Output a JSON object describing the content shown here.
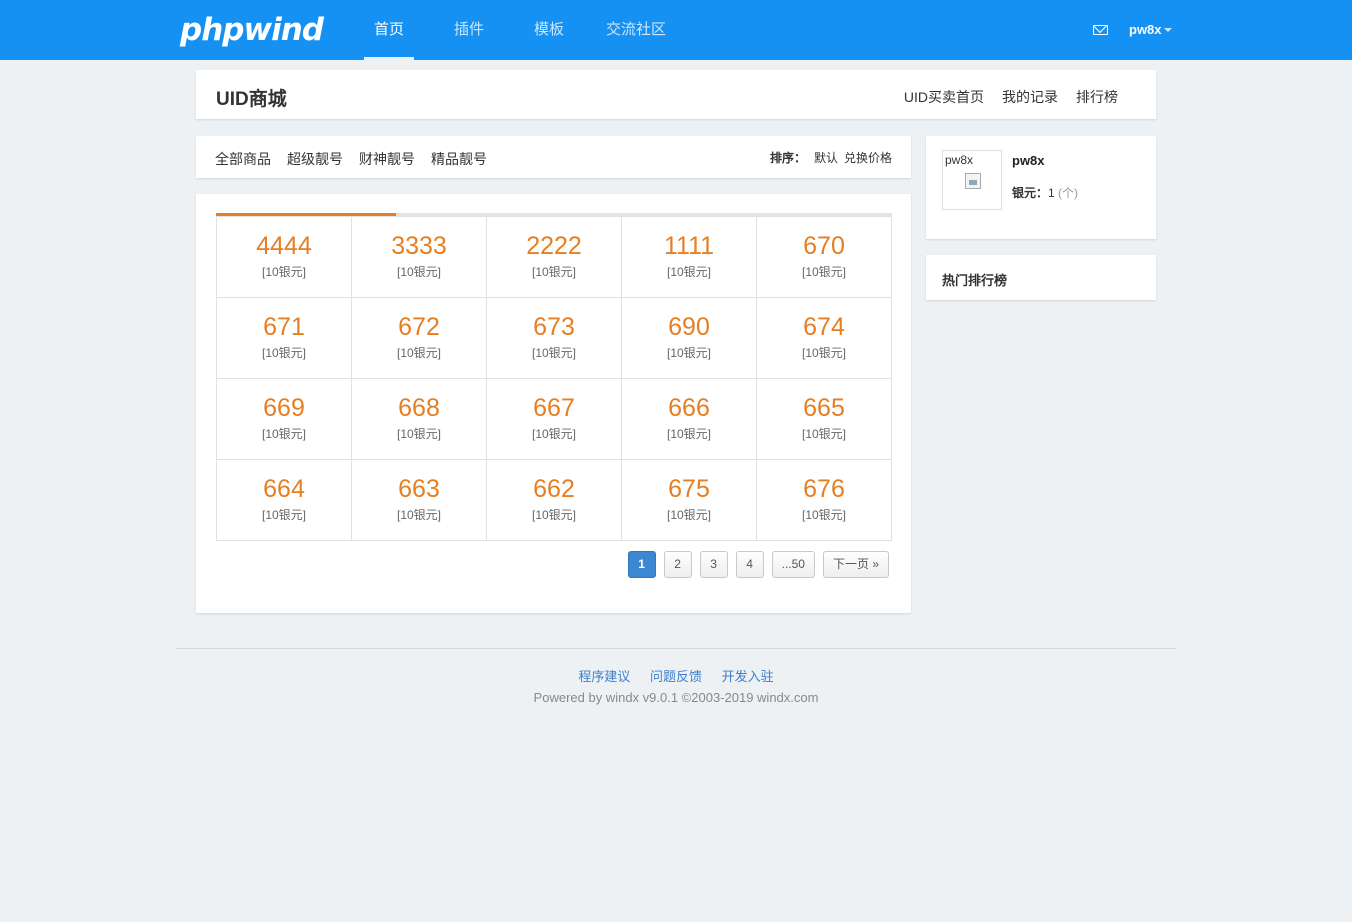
{
  "header": {
    "logo": "phpwind",
    "nav": [
      {
        "label": "首页",
        "active": true
      },
      {
        "label": "插件",
        "active": false
      },
      {
        "label": "模板",
        "active": false
      },
      {
        "label": "交流社区",
        "active": false
      }
    ],
    "mail_icon": "mail-icon",
    "username": "pw8x"
  },
  "title_bar": {
    "title": "UID商城",
    "links": [
      "UID买卖首页",
      "我的记录",
      "排行榜"
    ]
  },
  "filter": {
    "categories": [
      "全部商品",
      "超级靓号",
      "财神靓号",
      "精品靓号"
    ],
    "sort_label": "排序：",
    "sort_options": [
      "默认",
      "兑换价格"
    ]
  },
  "items": [
    {
      "uid": "4444",
      "price": "[10银元]"
    },
    {
      "uid": "3333",
      "price": "[10银元]"
    },
    {
      "uid": "2222",
      "price": "[10银元]"
    },
    {
      "uid": "1111",
      "price": "[10银元]"
    },
    {
      "uid": "670",
      "price": "[10银元]"
    },
    {
      "uid": "671",
      "price": "[10银元]"
    },
    {
      "uid": "672",
      "price": "[10银元]"
    },
    {
      "uid": "673",
      "price": "[10银元]"
    },
    {
      "uid": "690",
      "price": "[10银元]"
    },
    {
      "uid": "674",
      "price": "[10银元]"
    },
    {
      "uid": "669",
      "price": "[10银元]"
    },
    {
      "uid": "668",
      "price": "[10银元]"
    },
    {
      "uid": "667",
      "price": "[10银元]"
    },
    {
      "uid": "666",
      "price": "[10银元]"
    },
    {
      "uid": "665",
      "price": "[10银元]"
    },
    {
      "uid": "664",
      "price": "[10银元]"
    },
    {
      "uid": "663",
      "price": "[10银元]"
    },
    {
      "uid": "662",
      "price": "[10银元]"
    },
    {
      "uid": "675",
      "price": "[10银元]"
    },
    {
      "uid": "676",
      "price": "[10银元]"
    }
  ],
  "pagination": {
    "pages": [
      "1",
      "2",
      "3",
      "4",
      "...50"
    ],
    "current": "1",
    "next": "下一页 »"
  },
  "user_panel": {
    "avatar_alt": "pw8x",
    "username": "pw8x",
    "balance_label": "银元：",
    "balance_value": "1",
    "balance_unit": "(个)"
  },
  "ranking": {
    "title": "热门排行榜"
  },
  "footer": {
    "links": [
      "程序建议",
      "问题反馈",
      "开发入驻"
    ],
    "copyright": "Powered by windx v9.0.1 ©2003-2019 windx.com"
  }
}
